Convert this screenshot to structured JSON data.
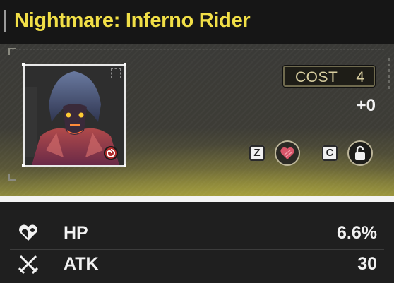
{
  "header": {
    "title": "Nightmare: Inferno Rider"
  },
  "card": {
    "cost_label": "COST",
    "cost_value": "4",
    "bonus": "+0",
    "key_heart": "Z",
    "key_lock": "C",
    "portrait_icon": "nightmare-rider-portrait",
    "element_icon": "spiral-element-icon"
  },
  "stats": [
    {
      "icon": "heart-icon",
      "name": "HP",
      "value": "6.6%"
    },
    {
      "icon": "crossed-swords-icon",
      "name": "ATK",
      "value": "30"
    }
  ],
  "colors": {
    "title": "#f1df47",
    "panel_glow": "#8e8a3e",
    "heart": "#d9566a"
  }
}
